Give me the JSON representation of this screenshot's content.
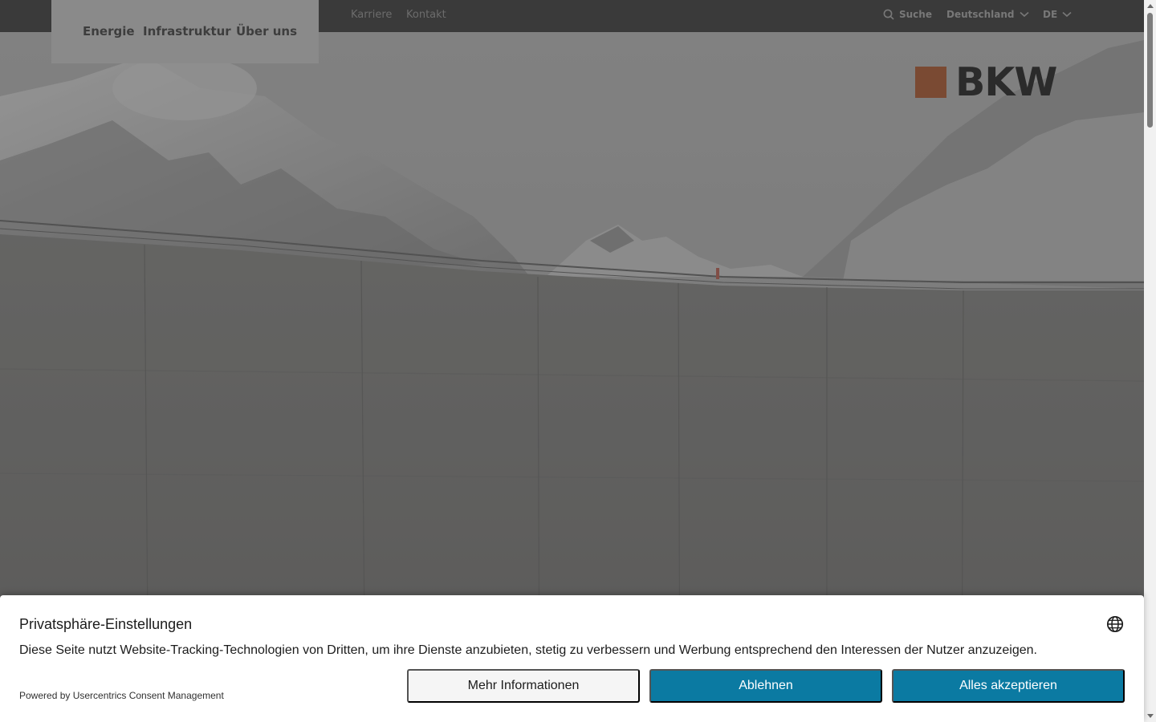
{
  "topbar": {
    "links": [
      "Karriere",
      "Kontakt"
    ],
    "search_label": "Suche",
    "country": "Deutschland",
    "language": "DE"
  },
  "nav": {
    "items": [
      "Energie",
      "Infrastruktur",
      "Über uns"
    ]
  },
  "logo": {
    "wordmark": "BKW",
    "brand_color": "#7a4a33"
  },
  "consent": {
    "title": "Privatsphäre-Einstellungen",
    "description": "Diese Seite nutzt Website-Tracking-Technologien von Dritten, um ihre Dienste anzubieten, stetig zu verbessern und Werbung entsprechend den Interessen der Nutzer anzuzeigen.",
    "powered_by": "Powered by Usercentrics Consent Management",
    "buttons": {
      "more": "Mehr Informationen",
      "deny": "Ablehnen",
      "accept": "Alles akzeptieren"
    },
    "accent_color": "#0b7aa2"
  },
  "icons": {
    "search": "search-icon",
    "chevron": "chevron-down-icon",
    "language": "globe-icon"
  }
}
